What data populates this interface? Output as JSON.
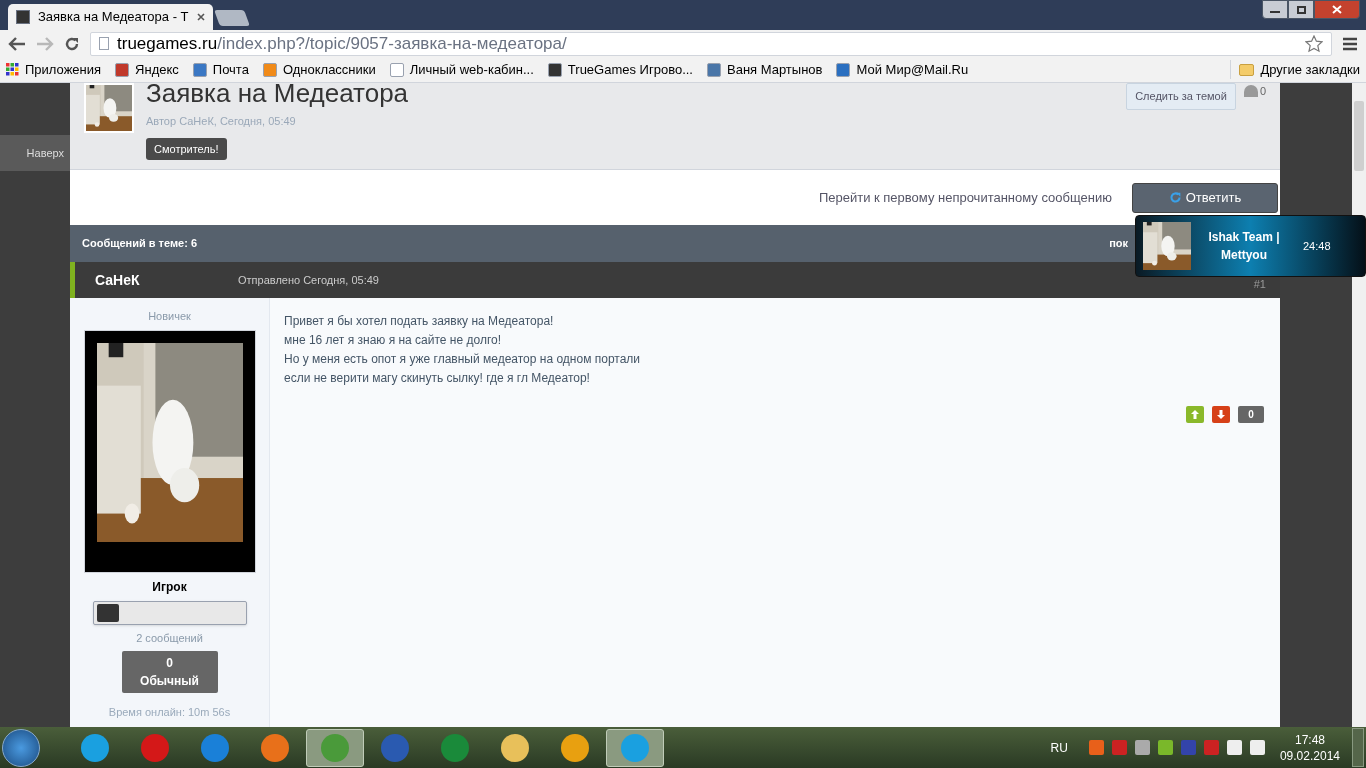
{
  "browser": {
    "tabs": [
      {
        "title": "Заявка на Медеатора - Т",
        "selected": true
      }
    ],
    "address": {
      "host": "truegames.ru",
      "path": "/index.php?/topic/9057-заявка-на-медеатора/"
    },
    "bookmarks": [
      {
        "label": "Приложения"
      },
      {
        "label": "Яндекс"
      },
      {
        "label": "Почта"
      },
      {
        "label": "Одноклассники"
      },
      {
        "label": "Личный web-кабин..."
      },
      {
        "label": "TrueGames Игрово..."
      },
      {
        "label": "Ваня Мартынов"
      },
      {
        "label": "Мой Мир@Mail.Ru"
      }
    ],
    "other_bookmarks": "Другие закладки"
  },
  "page": {
    "back_to_top": "Наверх",
    "topic": {
      "title": "Заявка на Медеатора",
      "byline": "Автор СаНеК, Сегодня, 05:49",
      "tag": "Смотритель!",
      "follow_button": "Следить за темой",
      "followers": "0"
    },
    "actions": {
      "unread_link": "Перейти к первому непрочитанному сообщению",
      "reply_button": "Ответить"
    },
    "thread_bar": {
      "count": "Сообщений в теме: 6",
      "right_text": "пок"
    },
    "post": {
      "author": "СаНеК",
      "sent": "Отправлено Сегодня, 05:49",
      "number": "#1",
      "rank": "Новичек",
      "group": "Игрок",
      "posts": "2 сообщений",
      "reputation": {
        "value": "0",
        "label": "Обычный"
      },
      "online": "Время онлайн: 10m 56s",
      "body": [
        "Привет я бы хотел подать заявку на Медеатора!",
        "мне 16 лет я знаю я на сайте не долго!",
        "Но у меня есть опот я уже главный медеатор на одном портали",
        "если не верити магу скинуть сылку! где я гл Медеатор!"
      ],
      "votes": "0"
    }
  },
  "notification": {
    "title": "Ishak Team | Mettyou",
    "time": "24:48"
  },
  "taskbar": {
    "apps": [
      {
        "selected": false
      },
      {
        "selected": false
      },
      {
        "selected": false
      },
      {
        "selected": false
      },
      {
        "selected": true
      },
      {
        "selected": false
      },
      {
        "selected": false
      },
      {
        "selected": false
      },
      {
        "selected": false
      },
      {
        "selected": true
      }
    ],
    "language": "RU",
    "time": "17:48",
    "date": "09.02.2014"
  }
}
